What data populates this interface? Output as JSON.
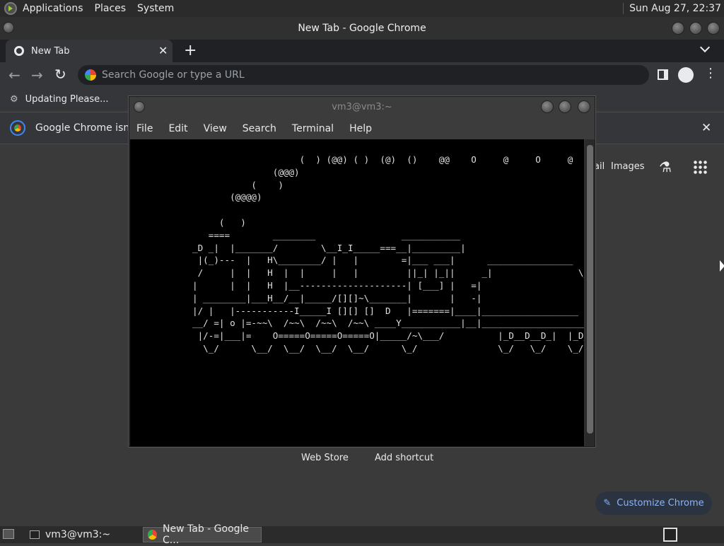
{
  "top_panel": {
    "menus": [
      "Applications",
      "Places",
      "System"
    ],
    "clock": "Sun Aug 27, 22:37"
  },
  "chrome": {
    "window_title": "New Tab - Google Chrome",
    "tab_title": "New Tab",
    "omnibox_placeholder": "Search Google or type a URL",
    "bookmark_label": "Updating Please...",
    "infobar_text": "Google Chrome isn't y",
    "ntp": {
      "gmail_fragment": "ail",
      "images_label": "Images",
      "shortcut_web_store": "Web Store",
      "shortcut_add": "Add shortcut",
      "customize_label": "Customize Chrome"
    }
  },
  "terminal": {
    "title": "vm3@vm3:~",
    "menus": [
      "File",
      "Edit",
      "View",
      "Search",
      "Terminal",
      "Help"
    ],
    "ascii_art": "                    (  ) (@@) ( )  (@)  ()    @@    O     @     O     @      O\n               (@@@)\n           (    )\n       (@@@@)\n\n     (   )\n   ====        ________                ___________\n_D _|  |_______/        \\__I_I_____===__|_________|\n |(_)---  |   H\\________/ |   |        =|___ ___|      ________________\n /     |  |   H  |  |     |   |         ||_| |_||     _|                \\_\n|      |  |   H  |__--------------------| [___] |   =|\n| ________|___H__/__|_____/[][]~\\_______|       |   -|\n|/ |   |-----------I_____I [][] []  D   |=======|____|__________________\n__/ =| o |=-~~\\  /~~\\  /~~\\  /~~\\ ____Y___________|__|____________________\n |/-=|___|=    O=====O=====O=====O|_____/~\\___/          |_D__D__D_|  |_D__\n  \\_/      \\__/  \\__/  \\__/  \\__/      \\_/               \\_/   \\_/    \\_/"
  },
  "bottom_panel": {
    "tasks": [
      "vm3@vm3:~",
      "New Tab - Google C..."
    ]
  }
}
